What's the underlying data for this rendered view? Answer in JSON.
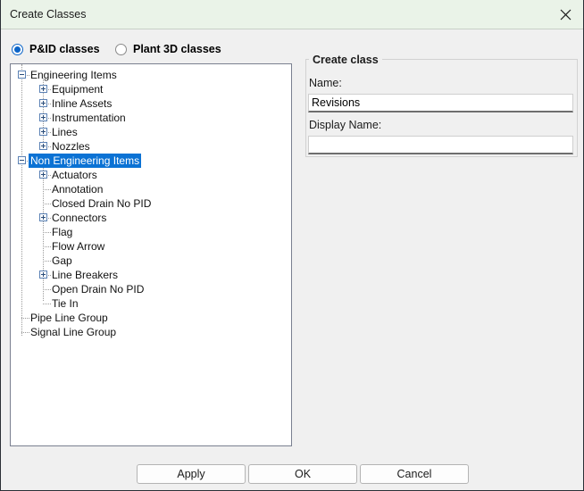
{
  "window": {
    "title": "Create Classes",
    "close_icon": "close-icon",
    "titlebar_color": "#eaf3e8",
    "accent_color": "#0b72d4"
  },
  "mode_options": [
    {
      "label": "P&ID classes",
      "selected": true
    },
    {
      "label": "Plant 3D classes",
      "selected": false
    }
  ],
  "tree": [
    {
      "label": "Engineering Items",
      "depth": 0,
      "expander": "minus",
      "selected": false
    },
    {
      "label": "Equipment",
      "depth": 1,
      "expander": "plus",
      "selected": false
    },
    {
      "label": "Inline Assets",
      "depth": 1,
      "expander": "plus",
      "selected": false
    },
    {
      "label": "Instrumentation",
      "depth": 1,
      "expander": "plus",
      "selected": false
    },
    {
      "label": "Lines",
      "depth": 1,
      "expander": "plus",
      "selected": false
    },
    {
      "label": "Nozzles",
      "depth": 1,
      "expander": "plus",
      "selected": false
    },
    {
      "label": "Non Engineering Items",
      "depth": 0,
      "expander": "minus",
      "selected": true
    },
    {
      "label": "Actuators",
      "depth": 1,
      "expander": "plus",
      "selected": false
    },
    {
      "label": "Annotation",
      "depth": 1,
      "expander": "none",
      "selected": false
    },
    {
      "label": "Closed Drain No PID",
      "depth": 1,
      "expander": "none",
      "selected": false
    },
    {
      "label": "Connectors",
      "depth": 1,
      "expander": "plus",
      "selected": false
    },
    {
      "label": "Flag",
      "depth": 1,
      "expander": "none",
      "selected": false
    },
    {
      "label": "Flow Arrow",
      "depth": 1,
      "expander": "none",
      "selected": false
    },
    {
      "label": "Gap",
      "depth": 1,
      "expander": "none",
      "selected": false
    },
    {
      "label": "Line Breakers",
      "depth": 1,
      "expander": "plus",
      "selected": false
    },
    {
      "label": "Open Drain No PID",
      "depth": 1,
      "expander": "none",
      "selected": false
    },
    {
      "label": "Tie In",
      "depth": 1,
      "expander": "none",
      "selected": false
    },
    {
      "label": "Pipe Line Group",
      "depth": 0,
      "expander": "none",
      "selected": false
    },
    {
      "label": "Signal Line Group",
      "depth": 0,
      "expander": "none",
      "selected": false
    }
  ],
  "create_class": {
    "group_title": "Create class",
    "name_label": "Name:",
    "name_value": "Revisions",
    "name_placeholder": "",
    "display_name_label": "Display Name:",
    "display_name_value": "",
    "display_name_placeholder": ""
  },
  "buttons": {
    "apply": "Apply",
    "ok": "OK",
    "cancel": "Cancel"
  }
}
